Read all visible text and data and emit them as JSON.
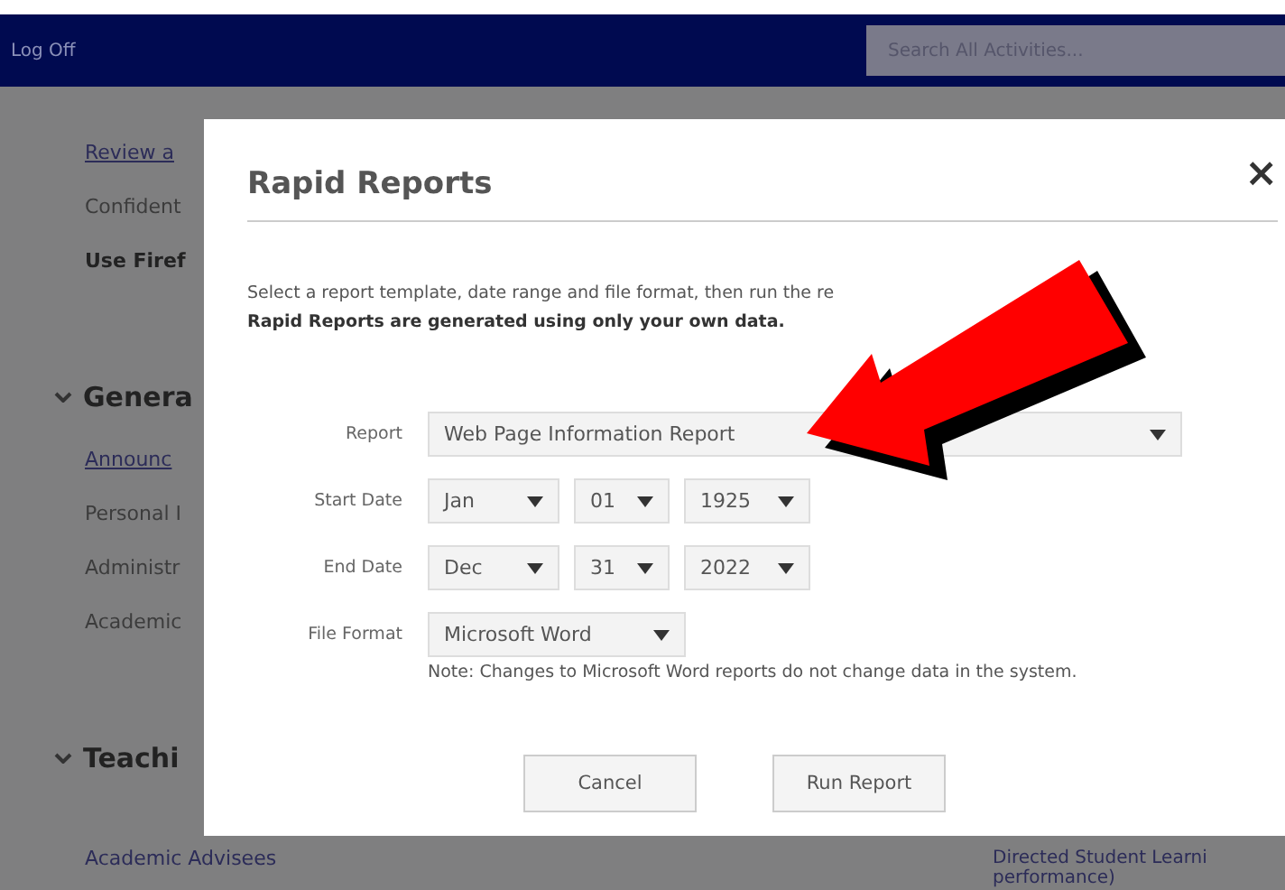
{
  "top_bar": {
    "link": "Log Off",
    "search": {
      "placeholder": "Search All Activities..."
    }
  },
  "background_page": {
    "items": [
      {
        "kind": "link",
        "text": "Review a"
      },
      {
        "kind": "text",
        "text": "Confident"
      },
      {
        "kind": "bold",
        "text": "Use Firef"
      },
      {
        "kind": "heading",
        "text": "Genera",
        "expanded": true
      },
      {
        "kind": "link",
        "text": "Announc"
      },
      {
        "kind": "text",
        "text": "Personal I"
      },
      {
        "kind": "text",
        "text": "Administr"
      },
      {
        "kind": "text",
        "text": "Academic"
      },
      {
        "kind": "heading",
        "text": "Teachi",
        "expanded": true
      },
      {
        "kind": "pair",
        "text": "Academic Advisees",
        "right": "Directed Student Learni",
        "right_more": "performance)"
      }
    ]
  },
  "dialog": {
    "title": "Rapid Reports",
    "close": "×",
    "intro": "Select a report template, date range and file format, then run the re",
    "notice": "Rapid Reports are generated using only your own data.",
    "fields": [
      {
        "kind": "select",
        "label": "Report",
        "value": "Web Page Information Report"
      },
      {
        "kind": "date",
        "label": "Start Date",
        "parts": [
          "Jan",
          "01",
          "1925"
        ]
      },
      {
        "kind": "date",
        "label": "End Date",
        "parts": [
          "Dec",
          "31",
          "2022"
        ]
      },
      {
        "kind": "format",
        "label": "File Format",
        "value": "Microsoft Word",
        "note": "Note: Changes to Microsoft Word reports do not change data in the system."
      }
    ],
    "buttons": [
      "Cancel",
      "Run Report"
    ]
  }
}
